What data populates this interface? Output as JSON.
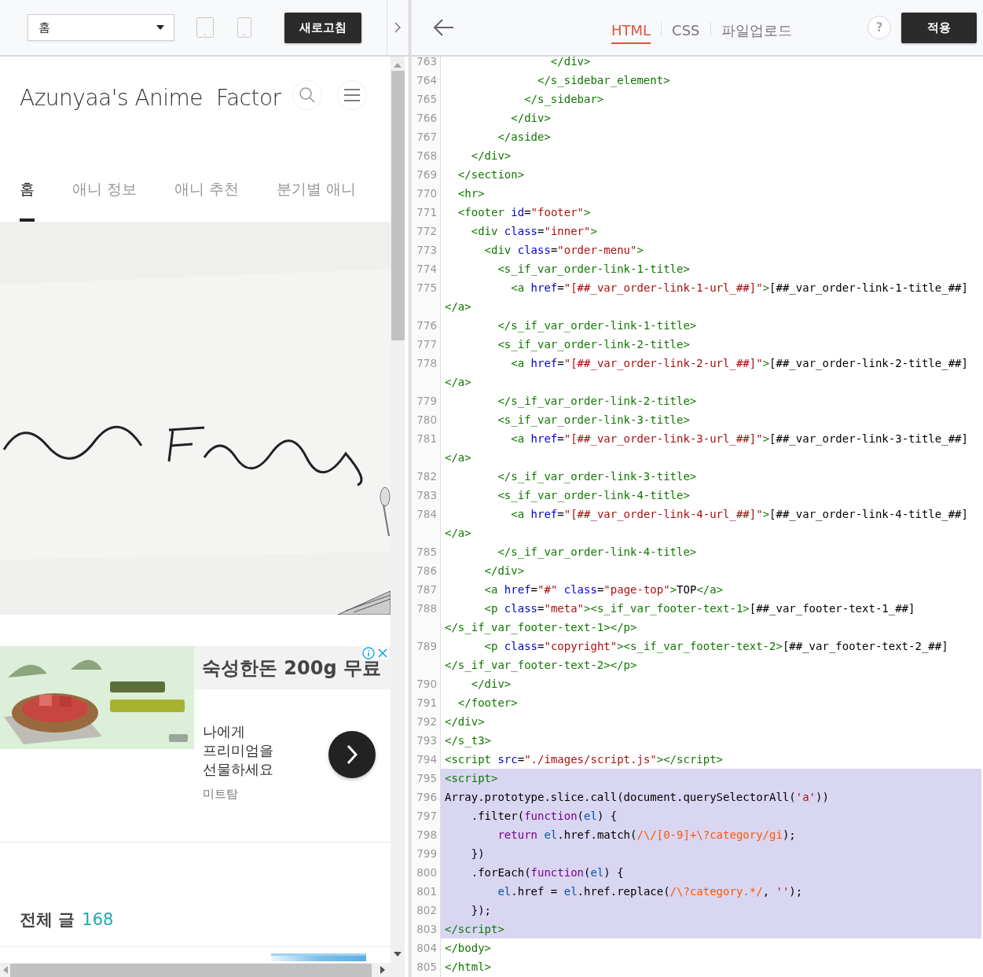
{
  "preview_toolbar": {
    "page_select": {
      "value": "홈"
    },
    "refresh_button": "새로고침"
  },
  "blog": {
    "title": "Azunyaa's Anime  Factor",
    "nav": [
      {
        "label": "홈",
        "selected": true
      },
      {
        "label": "애니 정보",
        "selected": false
      },
      {
        "label": "애니 추천",
        "selected": false
      },
      {
        "label": "분기별 애니",
        "selected": false
      }
    ],
    "ad": {
      "headline": "숙성한돈 200g 무료",
      "body": "나에게 프리미엄을 선물하세요",
      "advertiser": "미트탐"
    },
    "post_count": {
      "label": "전체 글",
      "count": "168"
    }
  },
  "editor": {
    "tabs": [
      {
        "label": "HTML",
        "selected": true
      },
      {
        "label": "CSS",
        "selected": false
      },
      {
        "label": "파일업로드",
        "selected": false
      }
    ],
    "help": "?",
    "apply_button": "적용",
    "lines": [
      {
        "number": "763",
        "selected": false,
        "tokens": [
          {
            "kind": "tag",
            "text": "                </div>"
          }
        ]
      },
      {
        "number": "764",
        "selected": false,
        "tokens": [
          {
            "kind": "tag",
            "text": "              </s_sidebar_element>"
          }
        ]
      },
      {
        "number": "765",
        "selected": false,
        "tokens": [
          {
            "kind": "tag",
            "text": "            </s_sidebar>"
          }
        ]
      },
      {
        "number": "766",
        "selected": false,
        "tokens": [
          {
            "kind": "tag",
            "text": "          </div>"
          }
        ]
      },
      {
        "number": "767",
        "selected": false,
        "tokens": [
          {
            "kind": "tag",
            "text": "        </aside>"
          }
        ]
      },
      {
        "number": "768",
        "selected": false,
        "tokens": [
          {
            "kind": "tag",
            "text": "    </div>"
          }
        ]
      },
      {
        "number": "769",
        "selected": false,
        "tokens": [
          {
            "kind": "tag",
            "text": "  </section>"
          }
        ]
      },
      {
        "number": "770",
        "selected": false,
        "tokens": [
          {
            "kind": "tag",
            "text": "  <hr>"
          }
        ]
      },
      {
        "number": "771",
        "selected": false,
        "tokens": [
          {
            "kind": "tag",
            "text": "  <footer"
          },
          {
            "kind": "attr",
            "text": " id"
          },
          {
            "kind": "plain",
            "text": "="
          },
          {
            "kind": "string",
            "text": "\"footer\""
          },
          {
            "kind": "tag",
            "text": ">"
          }
        ]
      },
      {
        "number": "772",
        "selected": false,
        "tokens": [
          {
            "kind": "tag",
            "text": "    <div"
          },
          {
            "kind": "attr",
            "text": " class"
          },
          {
            "kind": "plain",
            "text": "="
          },
          {
            "kind": "string",
            "text": "\"inner\""
          },
          {
            "kind": "tag",
            "text": ">"
          }
        ]
      },
      {
        "number": "773",
        "selected": false,
        "tokens": [
          {
            "kind": "tag",
            "text": "      <div"
          },
          {
            "kind": "attr",
            "text": " class"
          },
          {
            "kind": "plain",
            "text": "="
          },
          {
            "kind": "string",
            "text": "\"order-menu\""
          },
          {
            "kind": "tag",
            "text": ">"
          }
        ]
      },
      {
        "number": "774",
        "selected": false,
        "tokens": [
          {
            "kind": "tag",
            "text": "        <s_if_var_order-link-1-title>"
          }
        ]
      },
      {
        "number": "775",
        "selected": false,
        "tokens": [
          {
            "kind": "tag",
            "text": "          <a"
          },
          {
            "kind": "attr",
            "text": " href"
          },
          {
            "kind": "plain",
            "text": "="
          },
          {
            "kind": "string",
            "text": "\"[##_var_order-link-1-url_##]\""
          },
          {
            "kind": "tag",
            "text": ">"
          },
          {
            "kind": "plain",
            "text": "[##_var_order-link-1-title_##]"
          }
        ],
        "wrap": [
          {
            "kind": "tag",
            "text": "</a>"
          }
        ]
      },
      {
        "number": "776",
        "selected": false,
        "tokens": [
          {
            "kind": "tag",
            "text": "        </s_if_var_order-link-1-title>"
          }
        ]
      },
      {
        "number": "777",
        "selected": false,
        "tokens": [
          {
            "kind": "tag",
            "text": "        <s_if_var_order-link-2-title>"
          }
        ]
      },
      {
        "number": "778",
        "selected": false,
        "tokens": [
          {
            "kind": "tag",
            "text": "          <a"
          },
          {
            "kind": "attr",
            "text": " href"
          },
          {
            "kind": "plain",
            "text": "="
          },
          {
            "kind": "string",
            "text": "\"[##_var_order-link-2-url_##]\""
          },
          {
            "kind": "tag",
            "text": ">"
          },
          {
            "kind": "plain",
            "text": "[##_var_order-link-2-title_##]"
          }
        ],
        "wrap": [
          {
            "kind": "tag",
            "text": "</a>"
          }
        ]
      },
      {
        "number": "779",
        "selected": false,
        "tokens": [
          {
            "kind": "tag",
            "text": "        </s_if_var_order-link-2-title>"
          }
        ]
      },
      {
        "number": "780",
        "selected": false,
        "tokens": [
          {
            "kind": "tag",
            "text": "        <s_if_var_order-link-3-title>"
          }
        ]
      },
      {
        "number": "781",
        "selected": false,
        "tokens": [
          {
            "kind": "tag",
            "text": "          <a"
          },
          {
            "kind": "attr",
            "text": " href"
          },
          {
            "kind": "plain",
            "text": "="
          },
          {
            "kind": "string",
            "text": "\"[##_var_order-link-3-url_##]\""
          },
          {
            "kind": "tag",
            "text": ">"
          },
          {
            "kind": "plain",
            "text": "[##_var_order-link-3-title_##]"
          }
        ],
        "wrap": [
          {
            "kind": "tag",
            "text": "</a>"
          }
        ]
      },
      {
        "number": "782",
        "selected": false,
        "tokens": [
          {
            "kind": "tag",
            "text": "        </s_if_var_order-link-3-title>"
          }
        ]
      },
      {
        "number": "783",
        "selected": false,
        "tokens": [
          {
            "kind": "tag",
            "text": "        <s_if_var_order-link-4-title>"
          }
        ]
      },
      {
        "number": "784",
        "selected": false,
        "tokens": [
          {
            "kind": "tag",
            "text": "          <a"
          },
          {
            "kind": "attr",
            "text": " href"
          },
          {
            "kind": "plain",
            "text": "="
          },
          {
            "kind": "string",
            "text": "\"[##_var_order-link-4-url_##]\""
          },
          {
            "kind": "tag",
            "text": ">"
          },
          {
            "kind": "plain",
            "text": "[##_var_order-link-4-title_##]"
          }
        ],
        "wrap": [
          {
            "kind": "tag",
            "text": "</a>"
          }
        ]
      },
      {
        "number": "785",
        "selected": false,
        "tokens": [
          {
            "kind": "tag",
            "text": "        </s_if_var_order-link-4-title>"
          }
        ]
      },
      {
        "number": "786",
        "selected": false,
        "tokens": [
          {
            "kind": "tag",
            "text": "      </div>"
          }
        ]
      },
      {
        "number": "787",
        "selected": false,
        "tokens": [
          {
            "kind": "tag",
            "text": "      <a"
          },
          {
            "kind": "attr",
            "text": " href"
          },
          {
            "kind": "plain",
            "text": "="
          },
          {
            "kind": "string",
            "text": "\"#\""
          },
          {
            "kind": "attr",
            "text": " class"
          },
          {
            "kind": "plain",
            "text": "="
          },
          {
            "kind": "string",
            "text": "\"page-top\""
          },
          {
            "kind": "tag",
            "text": ">"
          },
          {
            "kind": "plain",
            "text": "TOP"
          },
          {
            "kind": "tag",
            "text": "</a>"
          }
        ]
      },
      {
        "number": "788",
        "selected": false,
        "tokens": [
          {
            "kind": "tag",
            "text": "      <p"
          },
          {
            "kind": "attr",
            "text": " class"
          },
          {
            "kind": "plain",
            "text": "="
          },
          {
            "kind": "string",
            "text": "\"meta\""
          },
          {
            "kind": "tag",
            "text": "><s_if_var_footer-text-1>"
          },
          {
            "kind": "plain",
            "text": "[##_var_footer-text-1_##]"
          }
        ],
        "wrap": [
          {
            "kind": "tag",
            "text": "</s_if_var_footer-text-1></p>"
          }
        ]
      },
      {
        "number": "789",
        "selected": false,
        "tokens": [
          {
            "kind": "tag",
            "text": "      <p"
          },
          {
            "kind": "attr",
            "text": " class"
          },
          {
            "kind": "plain",
            "text": "="
          },
          {
            "kind": "string",
            "text": "\"copyright\""
          },
          {
            "kind": "tag",
            "text": "><s_if_var_footer-text-2>"
          },
          {
            "kind": "plain",
            "text": "[##_var_footer-text-2_##]"
          }
        ],
        "wrap": [
          {
            "kind": "tag",
            "text": "</s_if_var_footer-text-2></p>"
          }
        ]
      },
      {
        "number": "790",
        "selected": false,
        "tokens": [
          {
            "kind": "tag",
            "text": "    </div>"
          }
        ]
      },
      {
        "number": "791",
        "selected": false,
        "tokens": [
          {
            "kind": "tag",
            "text": "  </footer>"
          }
        ]
      },
      {
        "number": "792",
        "selected": false,
        "tokens": [
          {
            "kind": "tag",
            "text": "</div>"
          }
        ]
      },
      {
        "number": "793",
        "selected": false,
        "tokens": [
          {
            "kind": "tag",
            "text": "</s_t3>"
          }
        ]
      },
      {
        "number": "794",
        "selected": false,
        "tokens": [
          {
            "kind": "tag",
            "text": "<script"
          },
          {
            "kind": "attr",
            "text": " src"
          },
          {
            "kind": "plain",
            "text": "="
          },
          {
            "kind": "string",
            "text": "\"./images/script.js\""
          },
          {
            "kind": "tag",
            "text": "></script>"
          }
        ]
      },
      {
        "number": "795",
        "selected": true,
        "tokens": [
          {
            "kind": "tag",
            "text": "<script>"
          }
        ]
      },
      {
        "number": "796",
        "selected": true,
        "tokens": [
          {
            "kind": "plain",
            "text": "Array.prototype.slice.call(document.querySelectorAll("
          },
          {
            "kind": "string",
            "text": "'a'"
          },
          {
            "kind": "plain",
            "text": "))"
          }
        ]
      },
      {
        "number": "797",
        "selected": true,
        "tokens": [
          {
            "kind": "plain",
            "text": "    .filter("
          },
          {
            "kind": "keyword",
            "text": "function"
          },
          {
            "kind": "plain",
            "text": "("
          },
          {
            "kind": "variable",
            "text": "el"
          },
          {
            "kind": "plain",
            "text": ") {"
          }
        ]
      },
      {
        "number": "798",
        "selected": true,
        "tokens": [
          {
            "kind": "keyword",
            "text": "        return"
          },
          {
            "kind": "variable",
            "text": " el"
          },
          {
            "kind": "plain",
            "text": ".href.match("
          },
          {
            "kind": "regex",
            "text": "/\\/[0-9]+\\?category/gi"
          },
          {
            "kind": "plain",
            "text": ");"
          }
        ]
      },
      {
        "number": "799",
        "selected": true,
        "tokens": [
          {
            "kind": "plain",
            "text": "    })"
          }
        ]
      },
      {
        "number": "800",
        "selected": true,
        "tokens": [
          {
            "kind": "plain",
            "text": "    .forEach("
          },
          {
            "kind": "keyword",
            "text": "function"
          },
          {
            "kind": "plain",
            "text": "("
          },
          {
            "kind": "variable",
            "text": "el"
          },
          {
            "kind": "plain",
            "text": ") {"
          }
        ]
      },
      {
        "number": "801",
        "selected": true,
        "tokens": [
          {
            "kind": "variable",
            "text": "        el"
          },
          {
            "kind": "plain",
            "text": ".href = "
          },
          {
            "kind": "variable",
            "text": "el"
          },
          {
            "kind": "plain",
            "text": ".href.replace("
          },
          {
            "kind": "regex",
            "text": "/\\?category.*/"
          },
          {
            "kind": "plain",
            "text": ", "
          },
          {
            "kind": "string",
            "text": "''"
          },
          {
            "kind": "plain",
            "text": ");"
          }
        ]
      },
      {
        "number": "802",
        "selected": true,
        "tokens": [
          {
            "kind": "plain",
            "text": "    });"
          }
        ]
      },
      {
        "number": "803",
        "selected": true,
        "tokens": [
          {
            "kind": "tag",
            "text": "</script>"
          }
        ]
      },
      {
        "number": "804",
        "selected": false,
        "tokens": [
          {
            "kind": "tag",
            "text": "</body>"
          }
        ]
      },
      {
        "number": "805",
        "selected": false,
        "tokens": [
          {
            "kind": "tag",
            "text": "</html>"
          }
        ]
      }
    ]
  }
}
